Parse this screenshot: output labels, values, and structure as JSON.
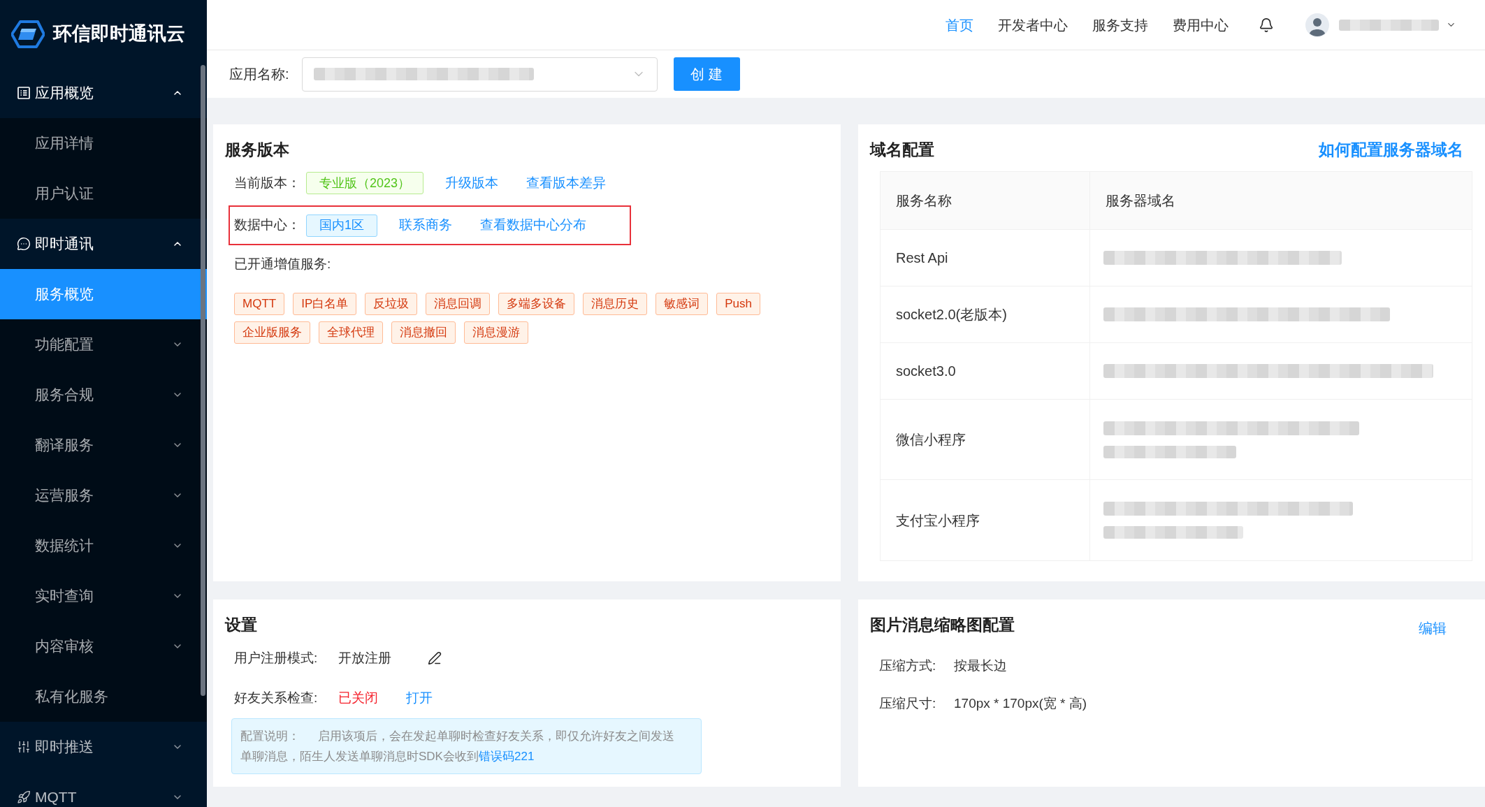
{
  "sidebar": {
    "logo": "环信即时通讯云",
    "items": [
      {
        "label": "应用概览",
        "selected": false,
        "expanded": true,
        "children": [
          {
            "label": "应用详情",
            "selected": false
          },
          {
            "label": "用户认证",
            "selected": false
          }
        ]
      },
      {
        "label": "即时通讯",
        "selected": false,
        "expanded": true,
        "children": [
          {
            "label": "服务概览",
            "selected": true
          },
          {
            "label": "功能配置",
            "selected": false,
            "expanded": false
          },
          {
            "label": "服务合规",
            "selected": false,
            "expanded": false
          },
          {
            "label": "翻译服务",
            "selected": false,
            "expanded": false
          },
          {
            "label": "运营服务",
            "selected": false,
            "expanded": false
          },
          {
            "label": "数据统计",
            "selected": false,
            "expanded": false
          },
          {
            "label": "实时查询",
            "selected": false,
            "expanded": false
          },
          {
            "label": "内容审核",
            "selected": false,
            "expanded": false
          },
          {
            "label": "私有化服务",
            "selected": false
          }
        ]
      },
      {
        "label": "即时推送",
        "selected": false,
        "expanded": false
      },
      {
        "label": "MQTT",
        "selected": false,
        "expanded": false
      }
    ]
  },
  "header": {
    "nav": [
      {
        "label": "首页",
        "selected": true
      },
      {
        "label": "开发者中心",
        "selected": false
      },
      {
        "label": "服务支持",
        "selected": false
      },
      {
        "label": "费用中心",
        "selected": false
      }
    ]
  },
  "app_bar": {
    "label": "应用名称:",
    "create_button": "创 建"
  },
  "service_version": {
    "title": "服务版本",
    "current_version": {
      "label": "当前版本：",
      "tag": "专业版（2023）",
      "links": [
        "升级版本",
        "查看版本差异"
      ]
    },
    "data_center": {
      "label": "数据中心：",
      "tag": "国内1区",
      "links": [
        "联系商务",
        "查看数据中心分布"
      ],
      "highlighted": true
    },
    "value_added": {
      "label": "已开通增值服务:",
      "tags": [
        "MQTT",
        "IP白名单",
        "反垃圾",
        "消息回调",
        "多端多设备",
        "消息历史",
        "敏感词",
        "Push",
        "企业版服务",
        "全球代理",
        "消息撤回",
        "消息漫游"
      ]
    }
  },
  "domain_config": {
    "title": "域名配置",
    "help_link": "如何配置服务器域名",
    "table": {
      "columns": [
        "服务名称",
        "服务器域名"
      ],
      "rows": [
        {
          "service": "Rest Api",
          "kind": "single"
        },
        {
          "service": "socket2.0(老版本)",
          "kind": "single"
        },
        {
          "service": "socket3.0",
          "kind": "single"
        },
        {
          "service": "微信小程序",
          "kind": "double"
        },
        {
          "service": "支付宝小程序",
          "kind": "double"
        }
      ]
    }
  },
  "settings": {
    "title": "设置",
    "registration": {
      "label": "用户注册模式:",
      "value": "开放注册"
    },
    "friend_check": {
      "label": "好友关系检查:",
      "status": "已关闭",
      "on": false,
      "action": "打开"
    },
    "note": {
      "label": "配置说明：",
      "text": "启用该项后，会在发起单聊时检查好友关系，即仅允许好友之间发送单聊消息，陌生人发送单聊消息时SDK会收到",
      "link": "错误码221"
    }
  },
  "thumbnail": {
    "title": "图片消息缩略图配置",
    "edit_link": "编辑",
    "fields": [
      {
        "label": "压缩方式:",
        "value": "按最长边"
      },
      {
        "label": "压缩尺寸:",
        "value": "170px * 170px(宽 * 高)"
      }
    ]
  }
}
